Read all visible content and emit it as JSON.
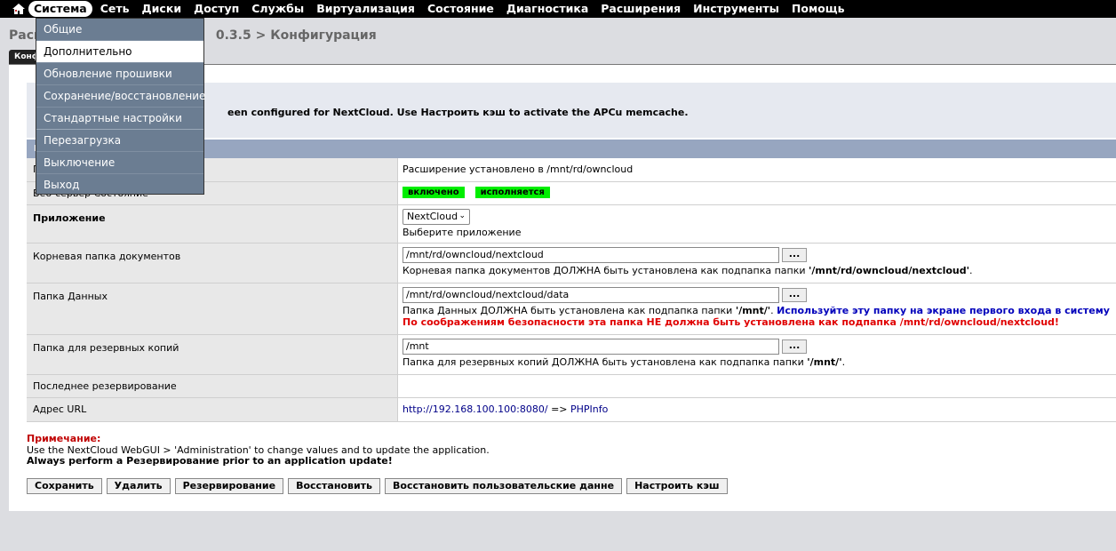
{
  "nav": {
    "items": [
      "Система",
      "Сеть",
      "Диски",
      "Доступ",
      "Службы",
      "Виртуализация",
      "Состояние",
      "Диагностика",
      "Расширения",
      "Инструменты",
      "Помощь"
    ],
    "active": "Система"
  },
  "breadcrumb": {
    "left": "Расш",
    "right": "0.3.5 > Конфигурация"
  },
  "tab": {
    "label": "Конф"
  },
  "info": {
    "text": "een configured for NextCloud. Use Настроить кэш to activate the APCu memcache."
  },
  "section": {
    "header_char": "N"
  },
  "rows": {
    "extension": {
      "label": "П",
      "value": "Расширение установлено в /mnt/rd/owncloud"
    },
    "webserver": {
      "label": "Веб-сервер Состояние",
      "status1": "включено",
      "status2": "исполняется"
    },
    "app": {
      "label": "Приложение",
      "selected": "NextCloud",
      "hint": "Выберите приложение"
    },
    "docroot": {
      "label": "Корневая папка документов",
      "value": "/mnt/rd/owncloud/nextcloud",
      "hint": "Корневая папка документов ДОЛЖНА быть установлена как подпапка папки ",
      "hint_bold": "'/mnt/rd/owncloud/nextcloud'",
      "hint_end": "."
    },
    "data": {
      "label": "Папка Данных",
      "value": "/mnt/rd/owncloud/nextcloud/data",
      "hint": "Папка Данных ДОЛЖНА быть установлена как подпапка папки ",
      "hint_bold": "'/mnt/'",
      "hint_end": ". ",
      "hint_blue": "Используйте эту папку на экране первого входа в систему",
      "hint_red": "По соображениям безопасности эта папка НЕ должна быть установлена как подпапка /mnt/rd/owncloud/nextcloud!"
    },
    "backup": {
      "label": "Папка для резервных копий",
      "value": "/mnt",
      "hint": "Папка для резервных копий ДОЛЖНА быть установлена как подпапка папки ",
      "hint_bold": "'/mnt/'",
      "hint_end": "."
    },
    "lastbackup": {
      "label": "Последнее резервирование",
      "value": ""
    },
    "url": {
      "label": "Адрес URL",
      "link": "http://192.168.100.100:8080/",
      "arrow": " => ",
      "phpinfo": "PHPInfo"
    }
  },
  "browse_label": "...",
  "note": {
    "title": "Примечание:",
    "line1": "Use the NextCloud WebGUI > 'Administration' to change values and to update the application.",
    "line2": "Always perform a Резервирование prior to an application update!"
  },
  "buttons": [
    "Сохранить",
    "Удалить",
    "Резервирование",
    "Восстановить",
    "Восстановить пользовательские данне",
    "Настроить кэш"
  ],
  "dropdown": {
    "items": [
      "Общие",
      "Дополнительно",
      "Обновление прошивки",
      "Сохранение/восстановление",
      "Стандартные настройки",
      "Перезагрузка",
      "Выключение",
      "Выход"
    ],
    "highlighted": "Дополнительно"
  }
}
